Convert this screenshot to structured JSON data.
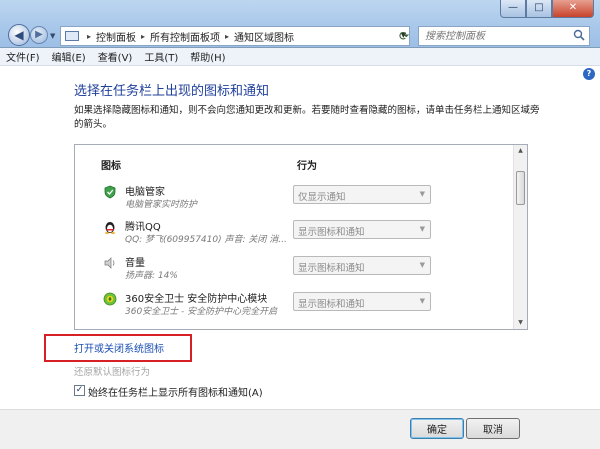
{
  "window": {
    "title_controls": {
      "minimize": "—",
      "maximize": "□",
      "close": "✕"
    }
  },
  "address": {
    "breadcrumbs": [
      "控制面板",
      "所有控制面板项",
      "通知区域图标"
    ]
  },
  "search": {
    "placeholder": "搜索控制面板"
  },
  "menu": [
    "文件(F)",
    "编辑(E)",
    "查看(V)",
    "工具(T)",
    "帮助(H)"
  ],
  "content": {
    "heading": "选择在任务栏上出现的图标和通知",
    "description": "如果选择隐藏图标和通知，则不会向您通知更改和更新。若要随时查看隐藏的图标，请单击任务栏上通知区域旁的箭头。",
    "columns": {
      "icons": "图标",
      "behavior": "行为"
    },
    "rows": [
      {
        "name": "电脑管家",
        "subtitle": "电脑管家实时防护",
        "behavior": "仅显示通知",
        "icon": "shield-icon"
      },
      {
        "name": "腾讯QQ",
        "subtitle": "QQ: 梦飞(609957410)  声音: 关闭  消...",
        "behavior": "显示图标和通知",
        "icon": "qq-penguin-icon"
      },
      {
        "name": "音量",
        "subtitle": "扬声器: 14%",
        "behavior": "显示图标和通知",
        "icon": "speaker-icon"
      },
      {
        "name": "360安全卫士 安全防护中心模块",
        "subtitle": "360安全卫士 - 安全防护中心完全开启",
        "behavior": "显示图标和通知",
        "icon": "360-guard-icon"
      }
    ],
    "link_system_icons": "打开或关闭系统图标",
    "link_restore": "还原默认图标行为",
    "checkbox_label": "始终在任务栏上显示所有图标和通知(A)",
    "checkbox_checked": true
  },
  "footer": {
    "ok": "确定",
    "cancel": "取消"
  },
  "colors": {
    "highlight_box": "#d71f26",
    "link": "#1a4fb3",
    "heading": "#1f3f9a"
  }
}
